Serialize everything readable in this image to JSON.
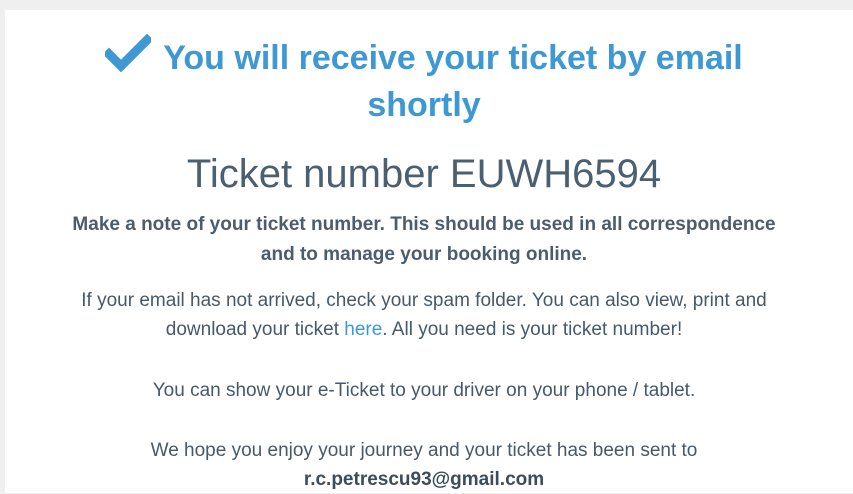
{
  "confirmation": {
    "headline_line1": "You will receive your ticket by email",
    "headline_line2": "shortly",
    "icon": "check-icon",
    "accent_color": "#3d98d3"
  },
  "ticket": {
    "label": "Ticket number EUWH6594"
  },
  "note": {
    "line1": "Make a note of your ticket number. This should be used in all correspondence",
    "line2": "and to manage your booking online."
  },
  "spam_info": {
    "line1": "If your email has not arrived, check your spam folder. You can also view, print and",
    "line2_prefix": "download your ticket ",
    "link_text": "here",
    "line2_suffix": ". All you need is your ticket number!"
  },
  "eticket": {
    "text": "You can show your e-Ticket to your driver on your phone / tablet."
  },
  "enjoy": {
    "line1": "We hope you enjoy your journey and your ticket has been sent to",
    "email": "r.c.petrescu93@gmail.com"
  }
}
